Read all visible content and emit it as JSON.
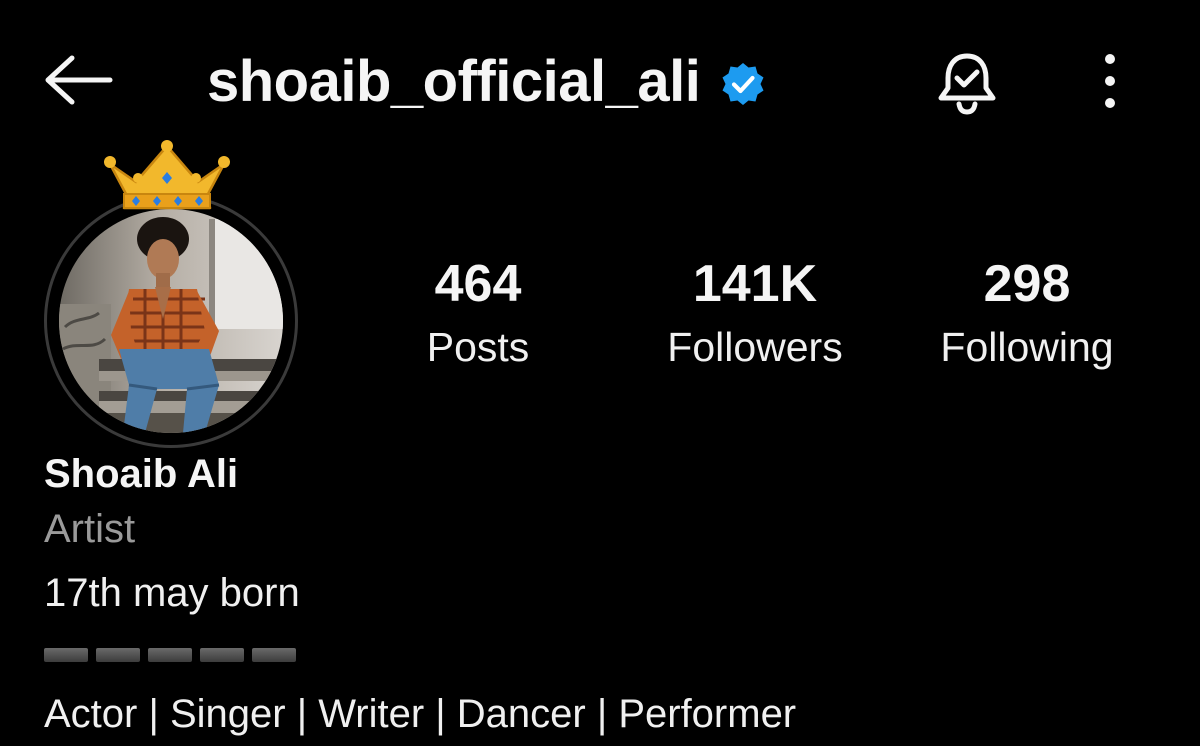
{
  "header": {
    "back_icon": "arrow-left-icon",
    "username": "shoaib_official_ali",
    "verified_icon": "verified-badge-icon",
    "notification_icon": "bell-check-icon",
    "more_icon": "vertical-ellipsis-icon"
  },
  "profile": {
    "avatar_decoration": "crown-emoji",
    "avatar_alt": "profile picture"
  },
  "stats": {
    "posts": {
      "value": "464",
      "label": "Posts"
    },
    "followers": {
      "value": "141K",
      "label": "Followers"
    },
    "following": {
      "value": "298",
      "label": "Following"
    }
  },
  "bio": {
    "name": "Shoaib Ali",
    "category": "Artist",
    "line1": "17th may born",
    "roles": "Actor | Singer | Writer | Dancer | Performer"
  },
  "colors": {
    "background": "#000000",
    "text": "#f5f5f5",
    "muted": "#9a9a9a",
    "verified": "#1d9bf0"
  }
}
